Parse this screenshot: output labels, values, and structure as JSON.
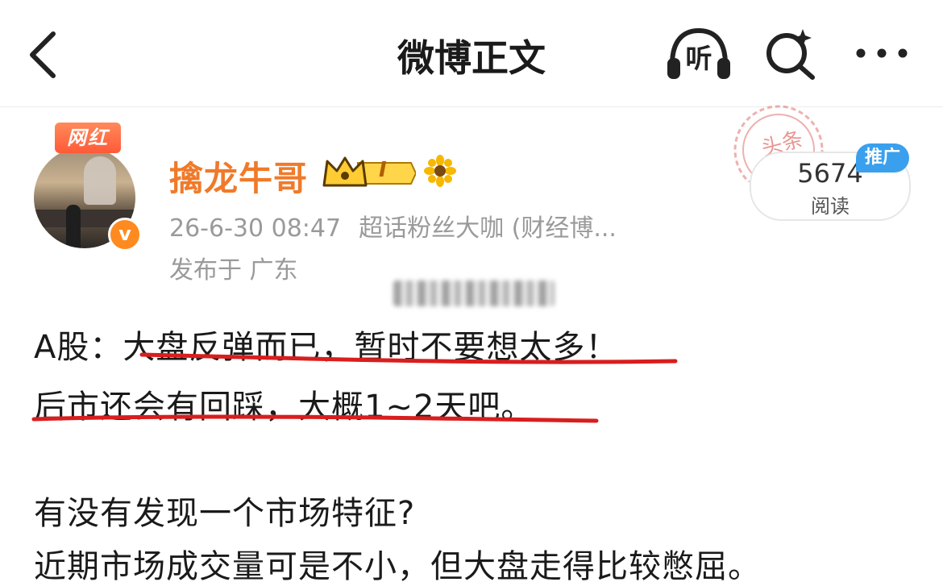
{
  "header": {
    "title": "微博正文",
    "listen_label": "听"
  },
  "post": {
    "author": {
      "name": "擒龙牛哥",
      "badge_label": "网红",
      "verified_mark": "v",
      "level": "I"
    },
    "timestamp": "26-6-30 08:47",
    "source": "超话粉丝大咖 (财经博...",
    "location": "发布于 广东",
    "stamp_text": "头条",
    "reads": {
      "count": "5674",
      "label": "阅读"
    },
    "promo_tag": "推广",
    "lines": [
      "A股：大盘反弹而已，暂时不要想太多！",
      "后市还会有回踩，大概1~2天吧。",
      "有没有发现一个市场特征?",
      "近期市场成交量可是不小，但大盘走得比较憋屈。"
    ]
  },
  "colors": {
    "username": "#f07a2a",
    "underline": "#d81e1e",
    "promo": "#3aa0ee",
    "verified": "#ff8a1f",
    "meta": "#9a9a9a"
  },
  "icons": [
    "back-arrow-icon",
    "headphone-icon",
    "search-sparkle-icon",
    "more-dots-icon",
    "crown-icon",
    "sunflower-icon"
  ]
}
